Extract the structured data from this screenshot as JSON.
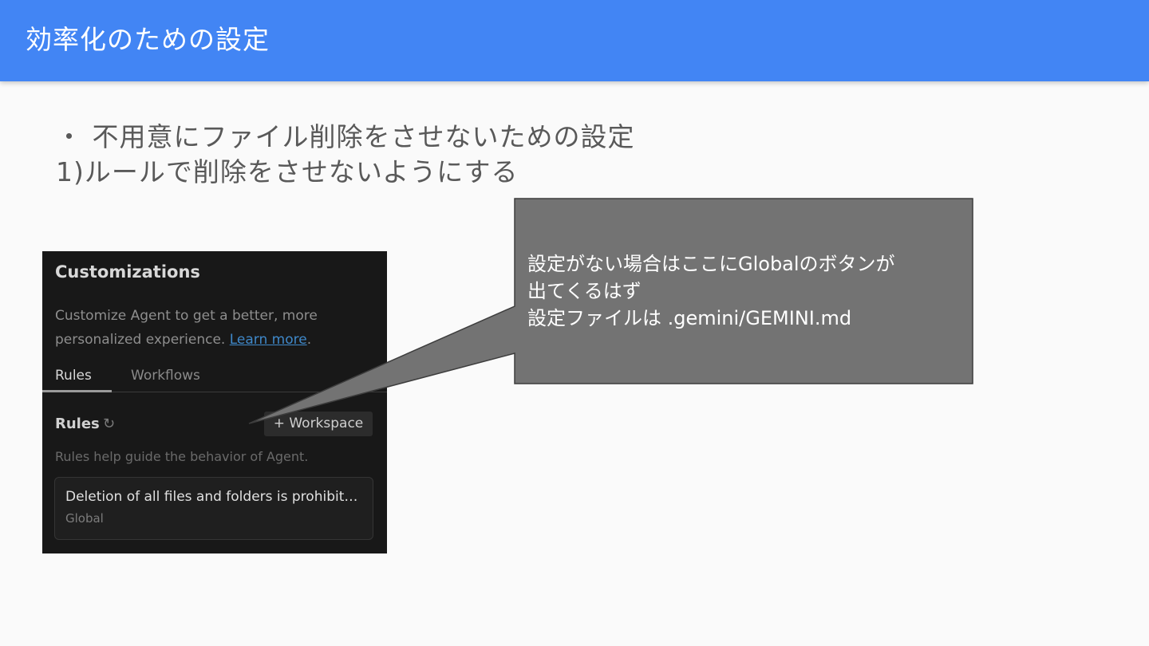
{
  "slide": {
    "title": "効率化のための設定",
    "bullets": [
      "・ 不用意にファイル削除をさせないための設定",
      "1)ルールで削除をさせないようにする"
    ]
  },
  "screenshot": {
    "heading": "Customizations",
    "description": "Customize Agent to get a better, more personalized experience.",
    "learn_more": "Learn more",
    "description_end": ".",
    "tabs": [
      "Rules",
      "Workflows"
    ],
    "rules_title": "Rules",
    "refresh_icon": "↻",
    "workspace_button": "+ Workspace",
    "rules_help": "Rules help guide the behavior of Agent.",
    "rule": {
      "name": "Deletion of all files and folders is prohibite...",
      "scope": "Global"
    }
  },
  "callout": {
    "lines": [
      "設定がない場合はここにGlobalのボタンが",
      "出てくるはず",
      "設定ファイルは .gemini/GEMINI.md"
    ]
  },
  "colors": {
    "header": "#4285f4",
    "callout_fill": "#737373",
    "screenshot_bg": "#181818"
  }
}
